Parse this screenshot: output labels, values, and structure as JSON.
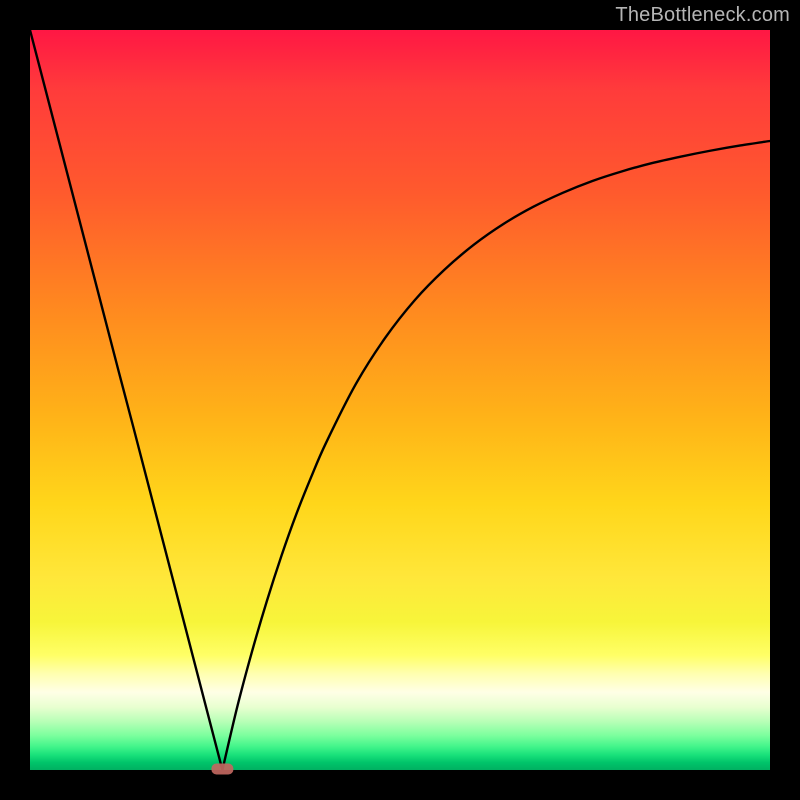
{
  "watermark": "TheBottleneck.com",
  "chart_data": {
    "type": "line",
    "title": "",
    "xlabel": "",
    "ylabel": "",
    "xlim": [
      0,
      100
    ],
    "ylim": [
      0,
      100
    ],
    "grid": false,
    "legend": false,
    "note": "Background is a vertical color gradient from red (top, ~100%) through orange and yellow to green (bottom, ~0%). A single black curve forms a V: a near-linear descending left branch from (0,100) to the minimum at ~(26,0), then a concave-up right branch rising toward ~(100,85). A small reddish marker sits at the minimum.",
    "series": [
      {
        "name": "curve",
        "x": [
          0,
          2,
          4,
          6,
          8,
          10,
          12,
          14,
          16,
          18,
          20,
          22,
          24,
          26,
          28,
          30,
          32,
          34,
          36,
          38,
          40,
          44,
          48,
          52,
          56,
          60,
          64,
          68,
          72,
          76,
          80,
          84,
          88,
          92,
          96,
          100
        ],
        "y": [
          100,
          92.3,
          84.6,
          76.9,
          69.2,
          61.5,
          53.8,
          46.2,
          38.5,
          30.8,
          23.1,
          15.4,
          7.7,
          0.0,
          8.5,
          16.0,
          22.8,
          29.0,
          34.6,
          39.6,
          44.2,
          52.1,
          58.4,
          63.5,
          67.6,
          71.0,
          73.8,
          76.1,
          78.0,
          79.6,
          80.9,
          82.0,
          82.9,
          83.7,
          84.4,
          85.0
        ]
      }
    ],
    "marker": {
      "x": 26,
      "y": 0,
      "color": "#c1675f",
      "shape": "rounded-rect"
    },
    "gradient_stops": [
      {
        "pos": 0,
        "color": "#ff1744"
      },
      {
        "pos": 30,
        "color": "#ff7a20"
      },
      {
        "pos": 60,
        "color": "#ffd21a"
      },
      {
        "pos": 82,
        "color": "#fff94a"
      },
      {
        "pos": 90,
        "color": "#ffffe0"
      },
      {
        "pos": 100,
        "color": "#00b061"
      }
    ]
  }
}
